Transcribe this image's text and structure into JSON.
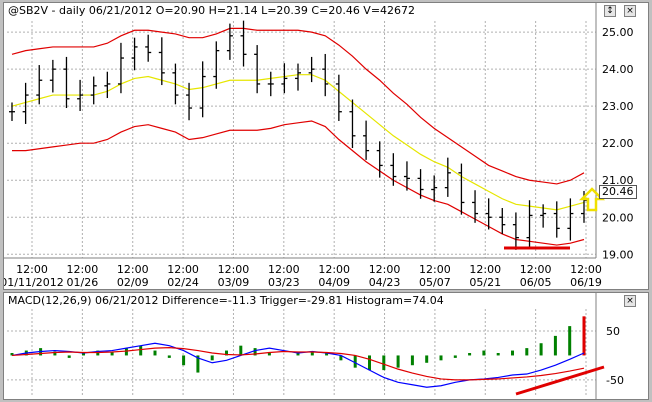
{
  "price_panel": {
    "title": "@SB2V - daily 06/21/2012 O=20.90 H=21.14 L=20.39 C=20.46 V=42672",
    "last_price": "20.46",
    "y_ticks": [
      "25.00",
      "24.00",
      "23.00",
      "22.00",
      "21.00",
      "20.00",
      "19.00"
    ],
    "x_ticks": [
      {
        "time": "12:00",
        "date": "01/11/2012"
      },
      {
        "time": "12:00",
        "date": "01/26"
      },
      {
        "time": "12:00",
        "date": "02/09"
      },
      {
        "time": "12:00",
        "date": "02/24"
      },
      {
        "time": "12:00",
        "date": "03/09"
      },
      {
        "time": "12:00",
        "date": "03/23"
      },
      {
        "time": "12:00",
        "date": "04/09"
      },
      {
        "time": "12:00",
        "date": "04/23"
      },
      {
        "time": "12:00",
        "date": "05/07"
      },
      {
        "time": "12:00",
        "date": "05/21"
      },
      {
        "time": "12:00",
        "date": "06/05"
      },
      {
        "time": "12:00",
        "date": "06/19"
      }
    ],
    "buttons": [
      "↕",
      "×"
    ],
    "colors": {
      "bars": "#000000",
      "ma": "#e6e600",
      "bands": "#e00000",
      "grid": "#b0b0b0",
      "annot_line": "#e00000",
      "arrow": "#f0e000"
    }
  },
  "macd_panel": {
    "title": "MACD(12,26,9) 06/21/2012 Difference=-11.3 Trigger=-29.81 Histogram=74.04",
    "y_ticks": [
      "50",
      "-50"
    ],
    "buttons": [
      "↕",
      "×"
    ],
    "colors": {
      "histogram": "#008000",
      "difference": "#0000ff",
      "trigger": "#e00000"
    }
  },
  "chart_data": [
    {
      "type": "bar",
      "title": "@SB2V - daily 06/21/2012 O=20.90 H=21.14 L=20.39 C=20.46 V=42672",
      "ylim": [
        18.9,
        25.3
      ],
      "x": [
        "01/11/2012",
        "01/26",
        "02/09",
        "02/24",
        "03/09",
        "03/23",
        "04/09",
        "04/23",
        "05/07",
        "05/21",
        "06/05",
        "06/19"
      ],
      "series": [
        {
          "values": [
            22.85,
            23.3,
            23.7,
            24.0,
            23.2,
            23.3,
            23.55,
            23.6,
            24.3,
            24.6,
            24.45,
            23.9,
            23.3,
            22.95,
            23.8,
            24.5,
            24.9,
            24.4,
            23.6,
            23.6,
            23.75,
            23.9,
            24.0,
            23.6,
            22.85,
            22.2,
            21.8,
            21.4,
            21.1,
            21.05,
            20.75,
            20.8,
            21.2,
            20.4,
            20.1,
            20.0,
            19.8,
            19.45,
            20.05,
            20.1,
            19.7,
            20.1,
            20.46
          ]
        },
        {
          "values": [
            23.0,
            23.1,
            23.2,
            23.3,
            23.3,
            23.3,
            23.3,
            23.4,
            23.6,
            23.75,
            23.8,
            23.7,
            23.6,
            23.45,
            23.5,
            23.6,
            23.7,
            23.7,
            23.7,
            23.75,
            23.8,
            23.85,
            23.85,
            23.7,
            23.4,
            23.1,
            22.8,
            22.5,
            22.2,
            21.95,
            21.7,
            21.5,
            21.35,
            21.1,
            20.9,
            20.7,
            20.5,
            20.35,
            20.3,
            20.25,
            20.2,
            20.3,
            20.4
          ]
        },
        {
          "values": [
            24.4,
            24.5,
            24.55,
            24.6,
            24.6,
            24.6,
            24.6,
            24.7,
            24.9,
            25.05,
            25.05,
            25.0,
            24.95,
            24.85,
            24.85,
            24.95,
            25.1,
            25.1,
            25.05,
            25.05,
            25.05,
            25.05,
            25.0,
            24.9,
            24.65,
            24.35,
            24.0,
            23.7,
            23.35,
            23.05,
            22.7,
            22.4,
            22.15,
            21.9,
            21.65,
            21.4,
            21.25,
            21.1,
            21.0,
            20.95,
            20.9,
            21.0,
            21.2
          ]
        },
        {
          "values": [
            21.8,
            21.8,
            21.85,
            21.9,
            21.95,
            22.0,
            22.0,
            22.1,
            22.3,
            22.45,
            22.5,
            22.4,
            22.3,
            22.1,
            22.15,
            22.25,
            22.35,
            22.35,
            22.35,
            22.4,
            22.5,
            22.55,
            22.6,
            22.45,
            22.1,
            21.8,
            21.5,
            21.25,
            21.0,
            20.8,
            20.6,
            20.45,
            20.35,
            20.15,
            19.95,
            19.75,
            19.55,
            19.4,
            19.35,
            19.3,
            19.25,
            19.3,
            19.4
          ]
        }
      ]
    },
    {
      "type": "bar",
      "title": "MACD(12,26,9) 06/21/2012 Difference=-11.3 Trigger=-29.81 Histogram=74.04",
      "ylim": [
        -85,
        95
      ],
      "series": [
        {
          "values": [
            5,
            10,
            15,
            8,
            -5,
            5,
            10,
            8,
            15,
            20,
            10,
            -5,
            -20,
            -35,
            -10,
            10,
            20,
            15,
            5,
            0,
            5,
            8,
            5,
            -10,
            -25,
            -30,
            -30,
            -25,
            -20,
            -15,
            -10,
            -5,
            5,
            10,
            5,
            10,
            15,
            25,
            40,
            60,
            80
          ]
        },
        {
          "values": [
            0,
            5,
            8,
            10,
            8,
            5,
            8,
            10,
            15,
            20,
            25,
            20,
            10,
            -5,
            -15,
            -10,
            0,
            10,
            15,
            10,
            5,
            8,
            5,
            0,
            -15,
            -30,
            -45,
            -55,
            -60,
            -65,
            -62,
            -55,
            -50,
            -48,
            -45,
            -40,
            -38,
            -30,
            -20,
            -8,
            5
          ]
        },
        {
          "values": [
            0,
            2,
            4,
            6,
            7,
            6,
            6,
            7,
            9,
            12,
            15,
            16,
            14,
            10,
            5,
            2,
            1,
            3,
            6,
            8,
            7,
            7,
            6,
            4,
            0,
            -8,
            -18,
            -28,
            -36,
            -43,
            -48,
            -50,
            -50,
            -49,
            -48,
            -46,
            -44,
            -41,
            -37,
            -32,
            -26
          ]
        }
      ]
    }
  ]
}
